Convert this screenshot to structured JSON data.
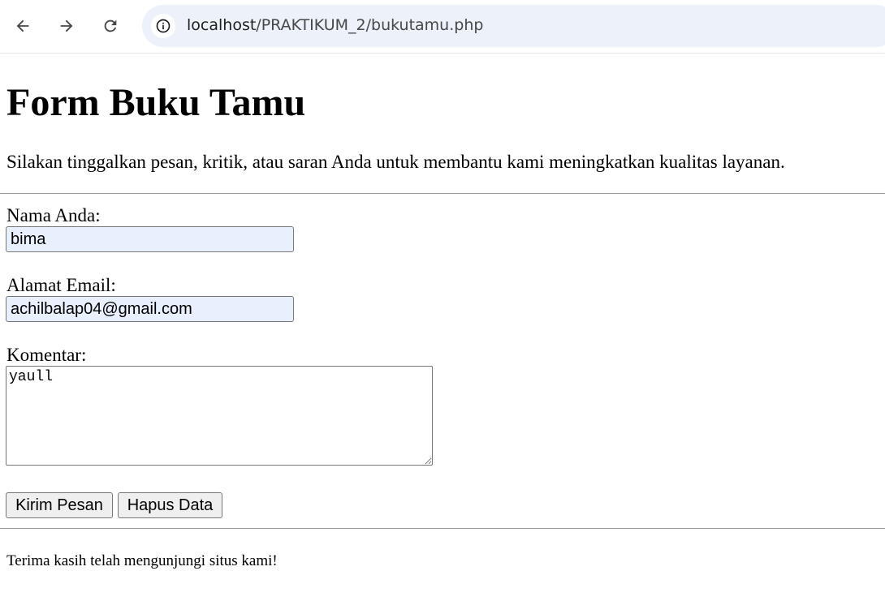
{
  "browser": {
    "url_host": "localhost",
    "url_path": "/PRAKTIKUM_2/bukutamu.php",
    "icons": {
      "back": "arrow-left-icon",
      "forward": "arrow-right-icon",
      "reload": "reload-icon",
      "site_info": "info-icon"
    }
  },
  "page": {
    "title": "Form Buku Tamu",
    "intro": "Silakan tinggalkan pesan, kritik, atau saran Anda untuk membantu kami meningkatkan kualitas layanan.",
    "footer": "Terima kasih telah mengunjungi situs kami!"
  },
  "form": {
    "name_label": "Nama Anda:",
    "name_value": "bima",
    "email_label": "Alamat Email:",
    "email_value": "achilbalap04@gmail.com",
    "comment_label": "Komentar:",
    "comment_value": "yaull",
    "submit_label": "Kirim Pesan",
    "reset_label": "Hapus Data"
  },
  "colors": {
    "address_bar_bg": "#edf2fa",
    "autofill_bg": "#e8f0fe",
    "button_bg": "#efefef"
  }
}
